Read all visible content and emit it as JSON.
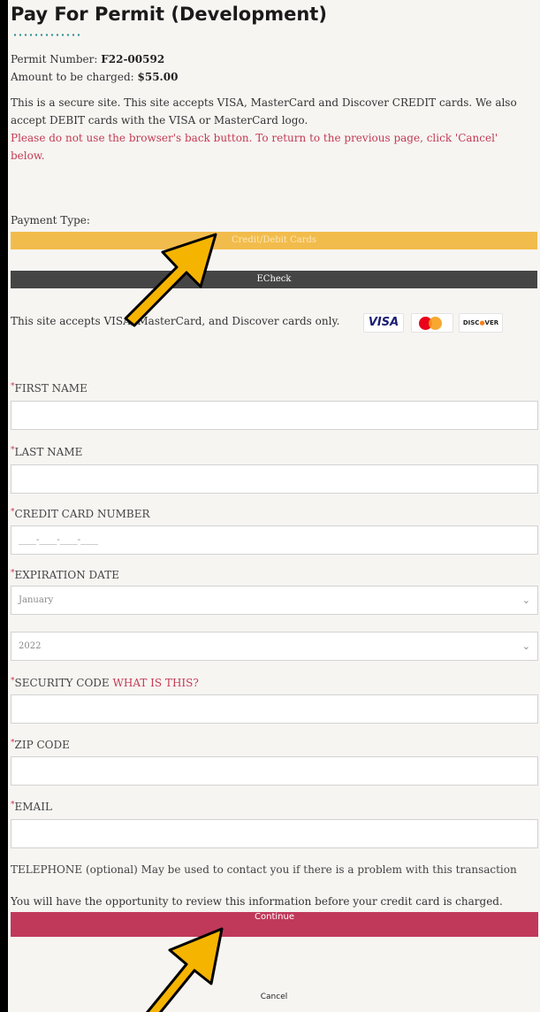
{
  "title": "Pay For Permit (Development)",
  "permit": {
    "label": "Permit Number:",
    "value": "F22-00592"
  },
  "amount": {
    "label": "Amount to be charged:",
    "value": "$55.00"
  },
  "info": "This is a secure site. This site accepts VISA, MasterCard and Discover CREDIT cards. We also accept DEBIT cards with the VISA or MasterCard logo.",
  "warning": "Please do not use the browser's back button. To return to the previous page, click 'Cancel' below.",
  "payment_type_label": "Payment Type:",
  "tabs": {
    "cards": "Credit/Debit Cards",
    "echeck": "ECheck"
  },
  "accepts_text": "This site accepts VISA, MasterCard, and Discover cards only.",
  "logos": {
    "visa": "VISA",
    "mastercard": "MasterCard",
    "discover_a": "DISC",
    "discover_b": "VER"
  },
  "fields": {
    "first_name": "FIRST NAME",
    "last_name": "LAST NAME",
    "card_number": "CREDIT CARD NUMBER",
    "card_number_placeholder": "____-____-____-____",
    "expiration": "EXPIRATION DATE",
    "month": "January",
    "year": "2022",
    "security_code": "SECURITY CODE",
    "what_is_this": "WHAT IS THIS?",
    "zip": "ZIP CODE",
    "email": "EMAIL",
    "telephone": "TELEPHONE (optional) May be used to contact you if there is a problem with this transaction",
    "telephone_placeholder": "(___) ___-____"
  },
  "review_text": "You will have the opportunity to review this information before your credit card is charged.",
  "buttons": {
    "continue": "Continue",
    "cancel": "Cancel"
  },
  "colors": {
    "accent_tab": "#f2bc4c",
    "echeck_tab": "#454545",
    "continue": "#c0395a",
    "required": "#c43a52",
    "arrow": "#f5b400"
  }
}
